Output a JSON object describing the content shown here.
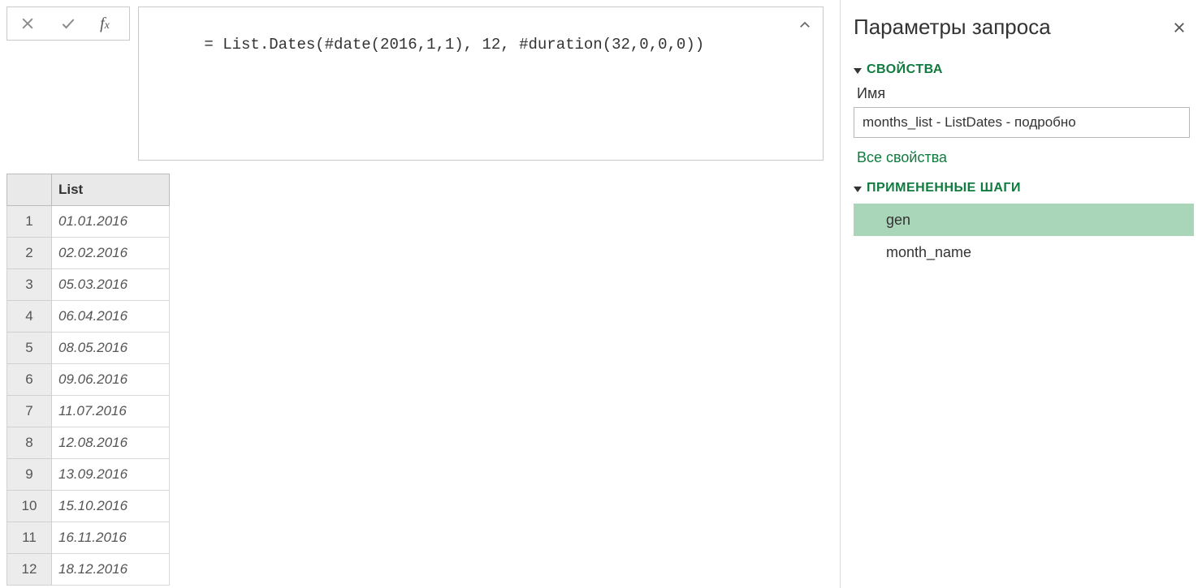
{
  "formula_bar": {
    "formula": "= List.Dates(#date(2016,1,1), 12, #duration(32,0,0,0))"
  },
  "grid": {
    "column_header": "List",
    "rows": [
      "01.01.2016",
      "02.02.2016",
      "05.03.2016",
      "06.04.2016",
      "08.05.2016",
      "09.06.2016",
      "11.07.2016",
      "12.08.2016",
      "13.09.2016",
      "15.10.2016",
      "16.11.2016",
      "18.12.2016"
    ]
  },
  "panel": {
    "title": "Параметры запроса",
    "properties_section": "СВОЙСТВА",
    "name_label": "Имя",
    "name_value": "months_list - ListDates - подробно",
    "all_properties_link": "Все свойства",
    "steps_section": "ПРИМЕНЕННЫЕ ШАГИ",
    "steps": [
      {
        "label": "gen",
        "selected": true
      },
      {
        "label": "month_name",
        "selected": false
      }
    ]
  }
}
